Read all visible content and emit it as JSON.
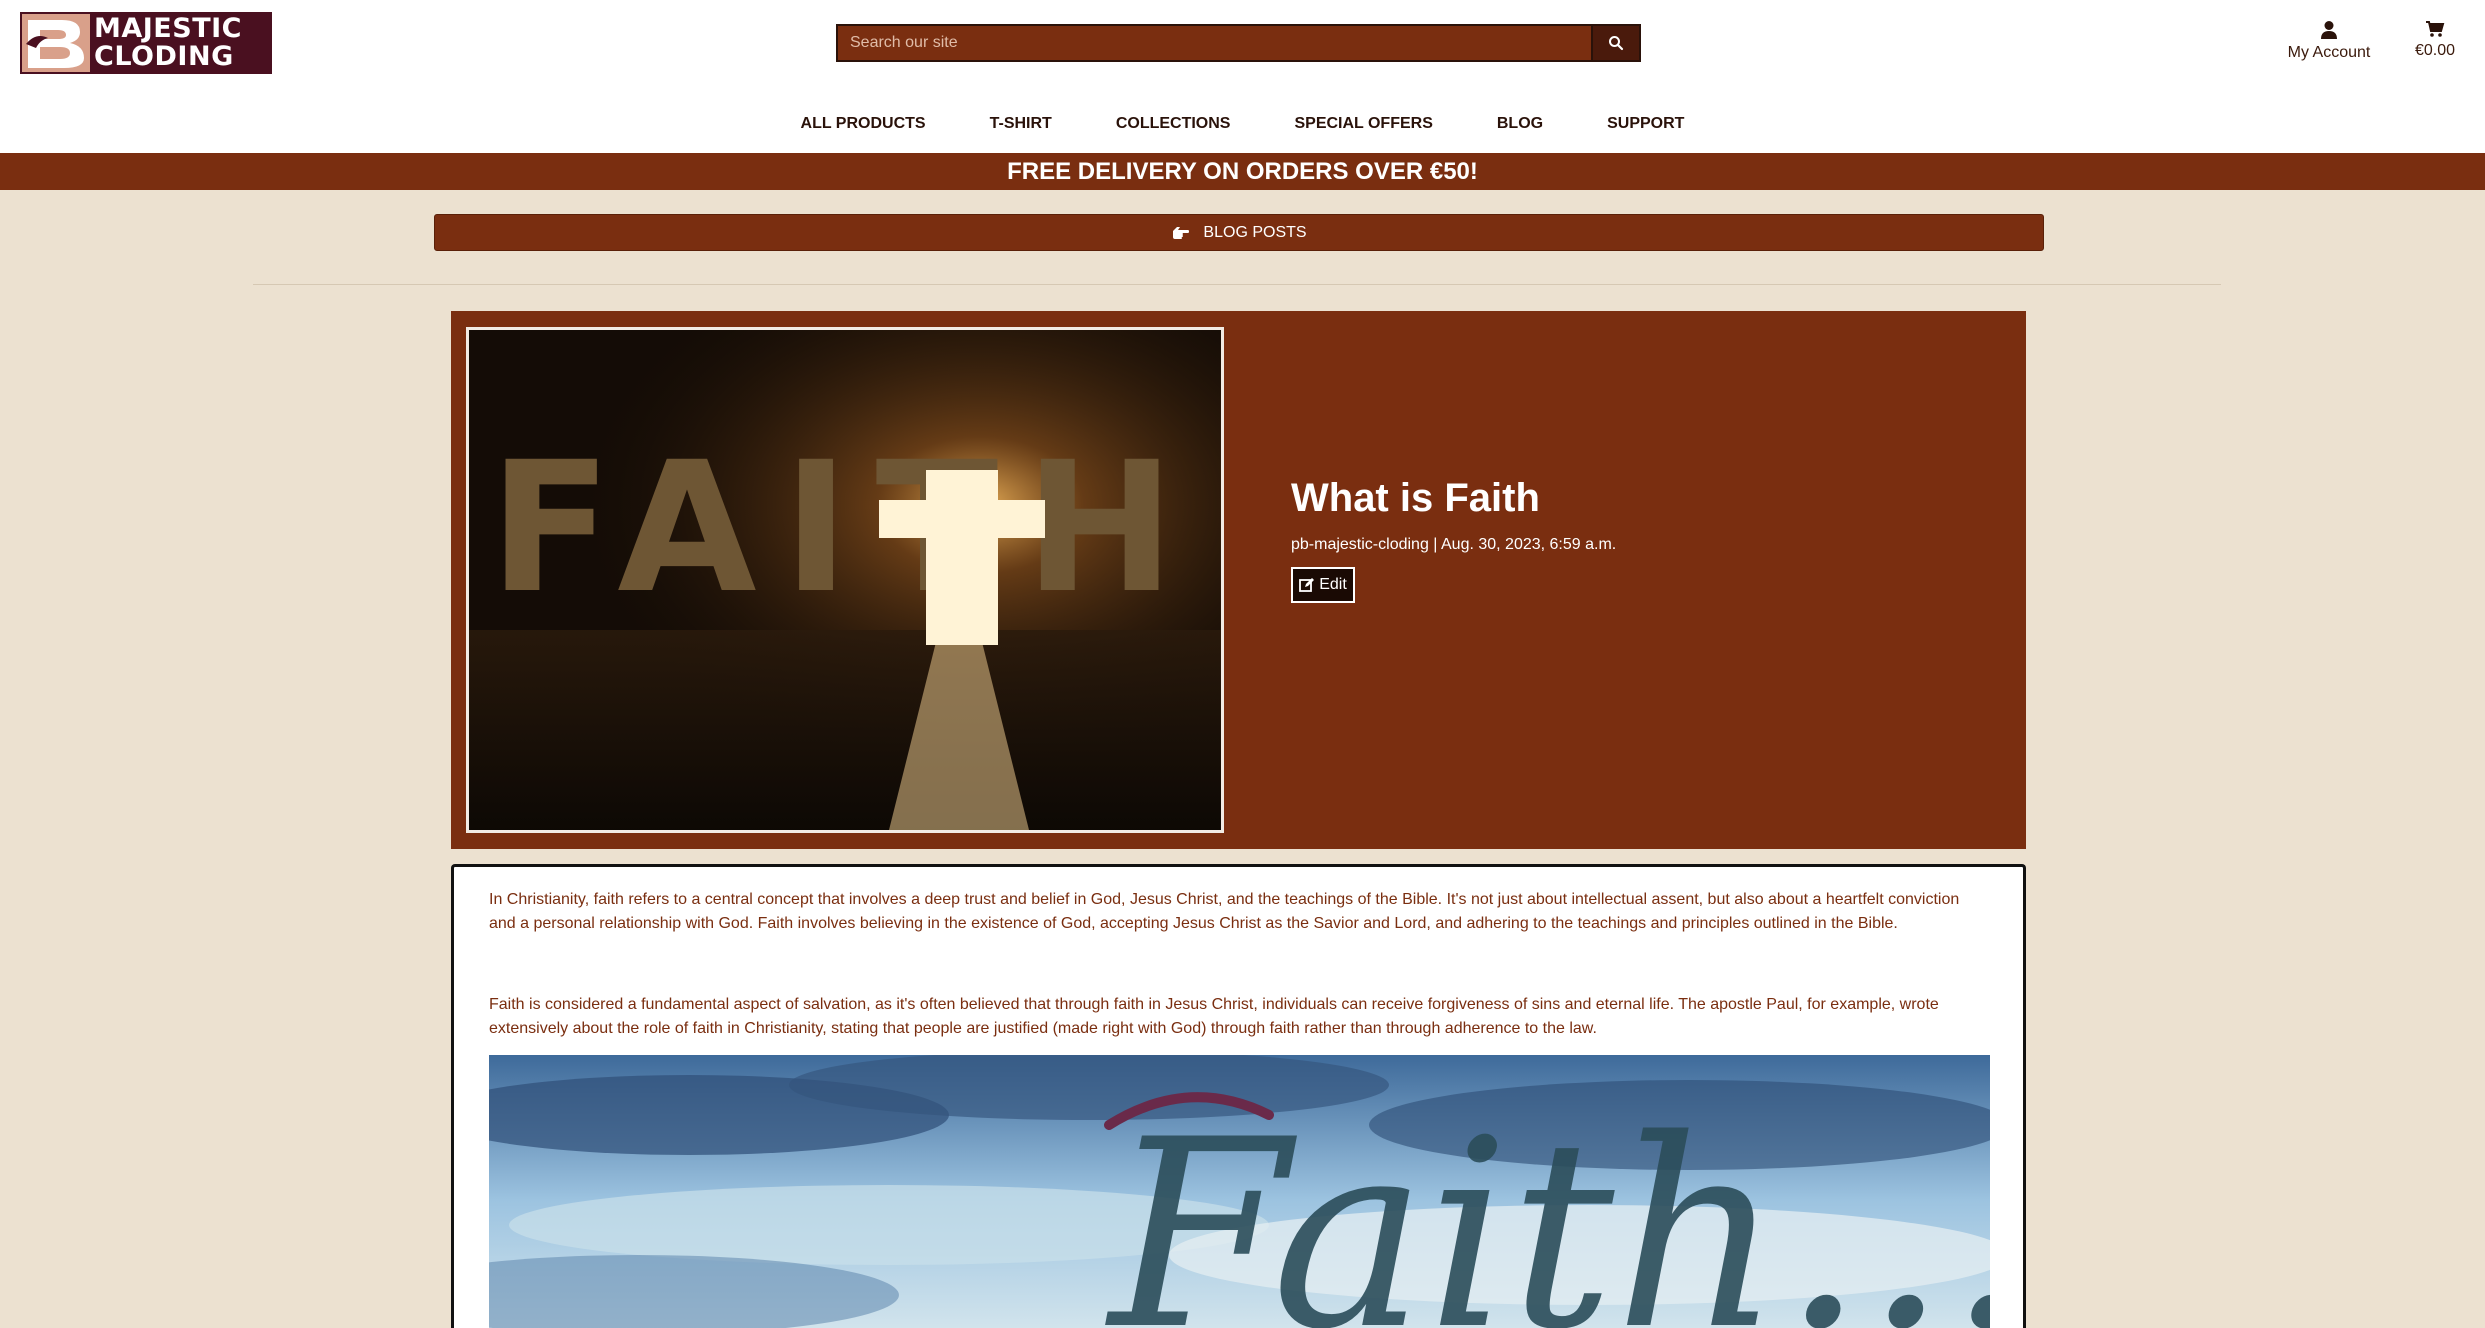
{
  "header": {
    "logo": {
      "line1": "MAJESTIC",
      "line2": "CLODING"
    },
    "search": {
      "placeholder": "Search our site"
    },
    "account_label": "My Account",
    "cart_total": "€0.00"
  },
  "nav": {
    "items": [
      {
        "label": "ALL PRODUCTS"
      },
      {
        "label": "T-SHIRT"
      },
      {
        "label": "COLLECTIONS"
      },
      {
        "label": "SPECIAL OFFERS"
      },
      {
        "label": "BLOG"
      },
      {
        "label": "SUPPORT"
      }
    ]
  },
  "banner": {
    "text": "FREE DELIVERY ON ORDERS OVER €50!"
  },
  "blog_bar": {
    "label": "BLOG POSTS"
  },
  "post": {
    "hero_image_text": "FAITH",
    "title": "What is Faith",
    "meta": "pb-majestic-cloding | Aug. 30, 2023, 6:59 a.m.",
    "edit_label": "Edit",
    "paragraphs": [
      "In Christianity, faith refers to a central concept that involves a deep trust and belief in God, Jesus Christ, and the teachings of the Bible. It's not just about intellectual assent, but also about a heartfelt conviction and a personal relationship with God. Faith involves believing in the existence of God, accepting Jesus Christ as the Savior and Lord, and adhering to the teachings and principles outlined in the Bible.",
      "Faith is considered a fundamental aspect of salvation, as it's often believed that through faith in Jesus Christ, individuals can receive forgiveness of sins and eternal life. The apostle Paul, for example, wrote extensively about the role of faith in Christianity, stating that people are justified (made right with God) through faith rather than through adherence to the law."
    ],
    "content_image_text": "Faith..."
  },
  "colors": {
    "brand": "#7a2e10",
    "logo_bg": "#4a1020",
    "page_bg": "#ece1d0"
  }
}
